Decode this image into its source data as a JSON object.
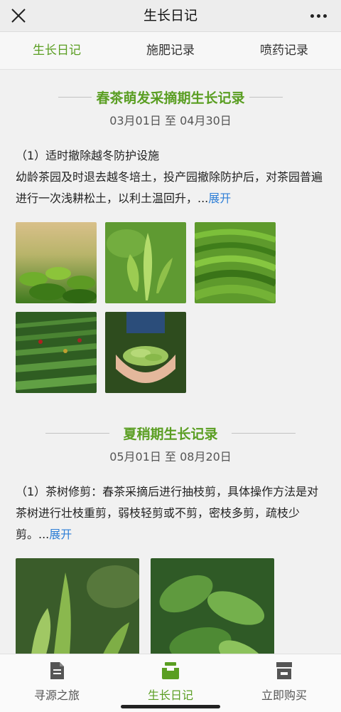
{
  "app": {
    "title": "生长日记"
  },
  "tabs": [
    {
      "label": "生长日记",
      "active": true
    },
    {
      "label": "施肥记录",
      "active": false
    },
    {
      "label": "喷药记录",
      "active": false
    }
  ],
  "records": [
    {
      "title": "春茶萌发采摘期生长记录",
      "date_range": "03月01日 至 04月30日",
      "body_heading": "（1）适时撤除越冬防护设施",
      "body_text": "幼龄茶园及时退去越冬培土，投产园撤除防护后，对茶园普遍进行一次浅耕松土，以利土温回升，...",
      "expand_label": "展开",
      "photos": [
        "tea-shoots-sunlit",
        "tea-bud-closeup",
        "terraced-tea-field",
        "tea-plantation-pickers",
        "hands-holding-tea-leaves"
      ]
    },
    {
      "title": "夏稍期生长记录",
      "date_range": "05月01日 至 08月20日",
      "body_heading": "",
      "body_text": "（1）茶树修剪：春茶采摘后进行抽枝剪，具体操作方法是对茶树进行壮枝重剪，弱枝轻剪或不剪，密枝多剪，疏枝少剪。...",
      "expand_label": "展开",
      "photos": [
        "tea-branch-closeup",
        "tea-bush-leaves"
      ]
    }
  ],
  "bottom_nav": [
    {
      "label": "寻源之旅",
      "icon": "document-icon",
      "active": false
    },
    {
      "label": "生长日记",
      "icon": "tray-icon",
      "active": true
    },
    {
      "label": "立即购买",
      "icon": "shop-icon",
      "active": false
    }
  ],
  "colors": {
    "accent": "#5a9e22",
    "link": "#2f7fd6",
    "background": "#f1f1f1"
  }
}
